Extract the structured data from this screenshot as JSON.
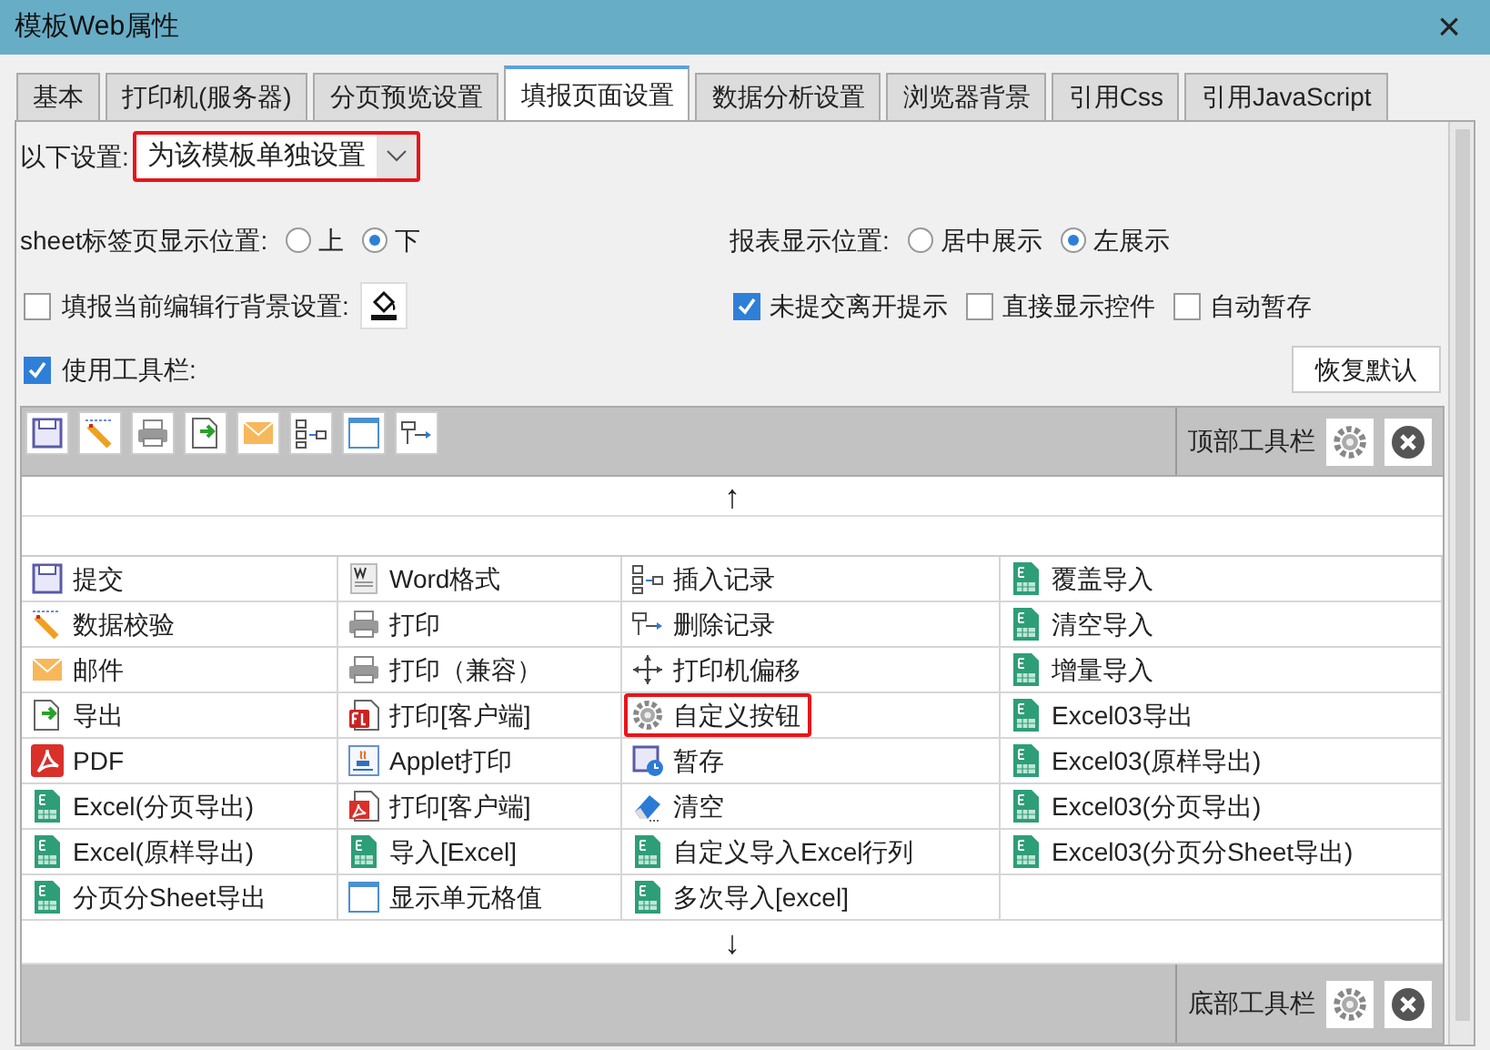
{
  "window": {
    "title": "模板Web属性",
    "close": "×"
  },
  "tabs": [
    {
      "label": "基本",
      "selected": false
    },
    {
      "label": "打印机(服务器)",
      "selected": false
    },
    {
      "label": "分页预览设置",
      "selected": false
    },
    {
      "label": "填报页面设置",
      "selected": true
    },
    {
      "label": "数据分析设置",
      "selected": false
    },
    {
      "label": "浏览器背景",
      "selected": false
    },
    {
      "label": "引用Css",
      "selected": false
    },
    {
      "label": "引用JavaScript",
      "selected": false
    }
  ],
  "settings": {
    "label": "以下设置:",
    "value": "为该模板单独设置",
    "highlighted": true
  },
  "sheet_tab_position": {
    "label": "sheet标签页显示位置:",
    "options": [
      {
        "label": "上",
        "selected": false
      },
      {
        "label": "下",
        "selected": true
      }
    ]
  },
  "report_position": {
    "label": "报表显示位置:",
    "options": [
      {
        "label": "居中展示",
        "selected": false
      },
      {
        "label": "左展示",
        "selected": true
      }
    ]
  },
  "row_background": {
    "label": "填报当前编辑行背景设置:",
    "checked": false
  },
  "checks": [
    {
      "label": "未提交离开提示",
      "checked": true
    },
    {
      "label": "直接显示控件",
      "checked": false
    },
    {
      "label": "自动暂存",
      "checked": false
    }
  ],
  "use_toolbar": {
    "label": "使用工具栏:",
    "checked": true
  },
  "restore_button": "恢复默认",
  "top_toolbar": {
    "label": "顶部工具栏",
    "buttons": [
      {
        "kind": "save"
      },
      {
        "kind": "pencil"
      },
      {
        "kind": "printer"
      },
      {
        "kind": "export"
      },
      {
        "kind": "mail"
      },
      {
        "kind": "insert"
      },
      {
        "kind": "window"
      },
      {
        "kind": "delete"
      }
    ]
  },
  "up_arrow": "↑",
  "items": [
    [
      {
        "label": "提交",
        "kind": "save",
        "highlighted": false
      },
      {
        "label": "Word格式",
        "kind": "word",
        "highlighted": false
      },
      {
        "label": "插入记录",
        "kind": "insert",
        "highlighted": false
      },
      {
        "label": "覆盖导入",
        "kind": "excel",
        "highlighted": false
      }
    ],
    [
      {
        "label": "数据校验",
        "kind": "pencil",
        "highlighted": false
      },
      {
        "label": "打印",
        "kind": "printer",
        "highlighted": false
      },
      {
        "label": "删除记录",
        "kind": "delete",
        "highlighted": false
      },
      {
        "label": "清空导入",
        "kind": "excel",
        "highlighted": false
      }
    ],
    [
      {
        "label": "邮件",
        "kind": "mail",
        "highlighted": false
      },
      {
        "label": "打印（兼容）",
        "kind": "printer",
        "highlighted": false
      },
      {
        "label": "打印机偏移",
        "kind": "move",
        "highlighted": false
      },
      {
        "label": "增量导入",
        "kind": "excel",
        "highlighted": false
      }
    ],
    [
      {
        "label": "导出",
        "kind": "export",
        "highlighted": false
      },
      {
        "label": "打印[客户端]",
        "kind": "flash",
        "highlighted": false
      },
      {
        "label": "自定义按钮",
        "kind": "gear",
        "highlighted": true
      },
      {
        "label": "Excel03导出",
        "kind": "excel",
        "highlighted": false
      }
    ],
    [
      {
        "label": "PDF",
        "kind": "pdf",
        "highlighted": false
      },
      {
        "label": "Applet打印",
        "kind": "applet",
        "highlighted": false
      },
      {
        "label": "暂存",
        "kind": "savetime",
        "highlighted": false
      },
      {
        "label": "Excel03(原样导出)",
        "kind": "excel",
        "highlighted": false
      }
    ],
    [
      {
        "label": "Excel(分页导出)",
        "kind": "excel",
        "highlighted": false
      },
      {
        "label": "打印[客户端]",
        "kind": "pdfdoc",
        "highlighted": false
      },
      {
        "label": "清空",
        "kind": "eraser",
        "highlighted": false
      },
      {
        "label": "Excel03(分页导出)",
        "kind": "excel",
        "highlighted": false
      }
    ],
    [
      {
        "label": "Excel(原样导出)",
        "kind": "excel",
        "highlighted": false
      },
      {
        "label": "导入[Excel]",
        "kind": "excel",
        "highlighted": false
      },
      {
        "label": "自定义导入Excel行列",
        "kind": "excel",
        "highlighted": false
      },
      {
        "label": "Excel03(分页分Sheet导出)",
        "kind": "excel",
        "highlighted": false
      }
    ],
    [
      {
        "label": "分页分Sheet导出",
        "kind": "excel",
        "highlighted": false
      },
      {
        "label": "显示单元格值",
        "kind": "window",
        "highlighted": false
      },
      {
        "label": "多次导入[excel]",
        "kind": "excel",
        "highlighted": false
      }
    ]
  ],
  "down_arrow": "↓",
  "bottom_toolbar": {
    "label": "底部工具栏"
  }
}
